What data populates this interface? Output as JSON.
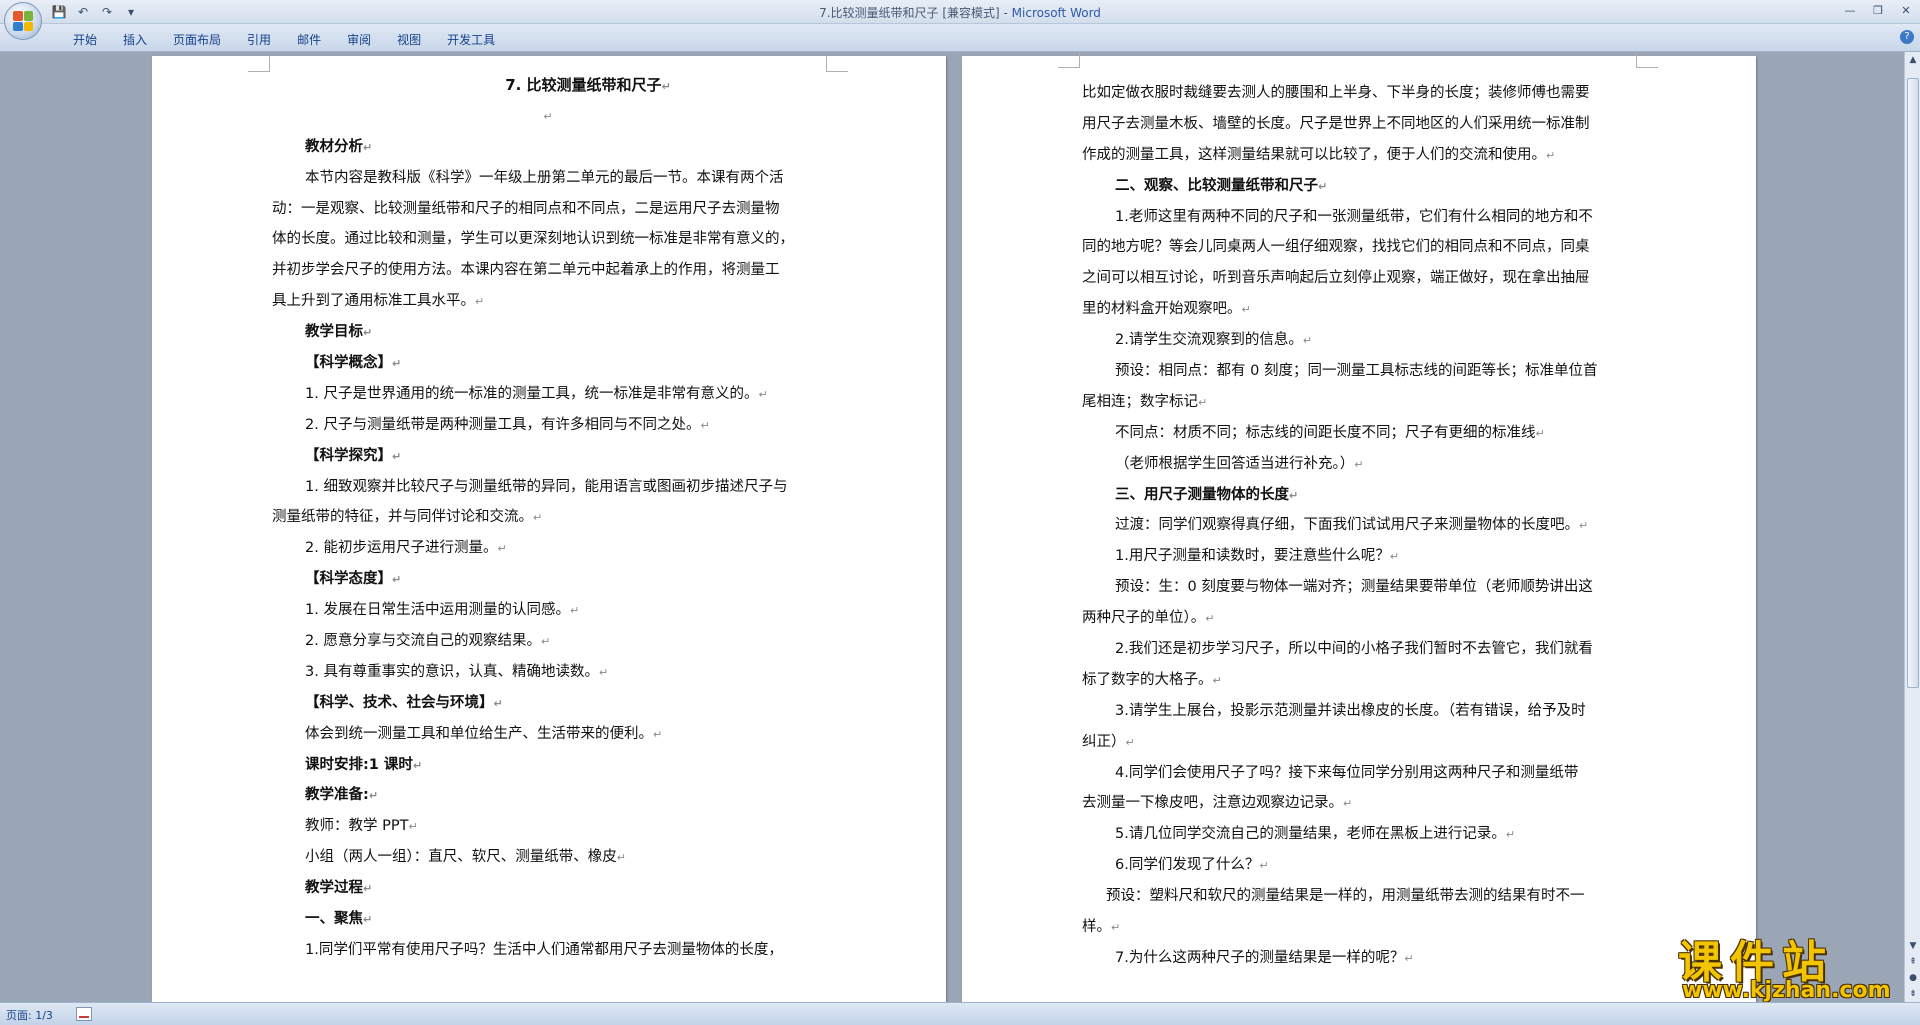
{
  "window": {
    "title_doc": "7.比较测量纸带和尺子 [兼容模式] - ",
    "title_app": "Microsoft Word"
  },
  "qat": {
    "save": "💾",
    "undo": "↶",
    "redo": "↷",
    "more": "▾"
  },
  "tabs": [
    "开始",
    "插入",
    "页面布局",
    "引用",
    "邮件",
    "审阅",
    "视图",
    "开发工具"
  ],
  "window_controls": {
    "minimize": "—",
    "restore": "❐",
    "close": "✕"
  },
  "paragraph_mark": "↵",
  "left_page": {
    "title": "7. 比较测量纸带和尺子",
    "lines": [
      {
        "text": "",
        "cls": "center"
      },
      {
        "text": "教材分析",
        "cls": "b ind"
      },
      {
        "text": "本节内容是教科版《科学》一年级上册第二单元的最后一节。本课有两个活",
        "cls": "ind",
        "noMark": true
      },
      {
        "text": "动：一是观察、比较测量纸带和尺子的相同点和不同点，二是运用尺子去测量物",
        "cls": "",
        "noMark": true
      },
      {
        "text": "体的长度。通过比较和测量，学生可以更深刻地认识到统一标准是非常有意义的，",
        "cls": "",
        "noMark": true
      },
      {
        "text": "并初步学会尺子的使用方法。本课内容在第二单元中起着承上的作用，将测量工",
        "cls": "",
        "noMark": true
      },
      {
        "text": "具上升到了通用标准工具水平。",
        "cls": ""
      },
      {
        "text": "教学目标",
        "cls": "b ind"
      },
      {
        "text": "【科学概念】",
        "cls": "b ind"
      },
      {
        "text": "1. 尺子是世界通用的统一标准的测量工具，统一标准是非常有意义的。",
        "cls": "ind"
      },
      {
        "text": "2. 尺子与测量纸带是两种测量工具，有许多相同与不同之处。",
        "cls": "ind"
      },
      {
        "text": "【科学探究】",
        "cls": "b ind"
      },
      {
        "text": "1. 细致观察并比较尺子与测量纸带的异同，能用语言或图画初步描述尺子与",
        "cls": "ind",
        "noMark": true
      },
      {
        "text": "测量纸带的特征，并与同伴讨论和交流。",
        "cls": ""
      },
      {
        "text": "2. 能初步运用尺子进行测量。",
        "cls": "ind"
      },
      {
        "text": "【科学态度】",
        "cls": "b ind"
      },
      {
        "text": "1. 发展在日常生活中运用测量的认同感。",
        "cls": "ind"
      },
      {
        "text": "2. 愿意分享与交流自己的观察结果。",
        "cls": "ind"
      },
      {
        "text": "3. 具有尊重事实的意识，认真、精确地读数。",
        "cls": "ind"
      },
      {
        "text": "【科学、技术、社会与环境】",
        "cls": "b ind"
      },
      {
        "text": "体会到统一测量工具和单位给生产、生活带来的便利。",
        "cls": "ind"
      },
      {
        "text": "课时安排:1 课时",
        "cls": "b ind"
      },
      {
        "text": "教学准备:",
        "cls": "b ind"
      },
      {
        "text": "教师：教学 PPT",
        "cls": "ind"
      },
      {
        "text": "小组（两人一组）：直尺、软尺、测量纸带、橡皮",
        "cls": "ind"
      },
      {
        "text": "教学过程",
        "cls": "b ind"
      },
      {
        "text": "一、聚焦",
        "cls": "b ind"
      },
      {
        "text": "1.同学们平常有使用尺子吗？生活中人们通常都用尺子去测量物体的长度，",
        "cls": "ind",
        "noMark": true
      }
    ]
  },
  "right_page": {
    "lines": [
      {
        "text": "比如定做衣服时裁缝要去测人的腰围和上半身、下半身的长度；装修师傅也需要",
        "cls": "",
        "noMark": true
      },
      {
        "text": "用尺子去测量木板、墙壁的长度。尺子是世界上不同地区的人们采用统一标准制",
        "cls": "",
        "noMark": true
      },
      {
        "text": "作成的测量工具，这样测量结果就可以比较了，便于人们的交流和使用。",
        "cls": ""
      },
      {
        "text": "二、观察、比较测量纸带和尺子",
        "cls": "b ind"
      },
      {
        "text": "1.老师这里有两种不同的尺子和一张测量纸带，它们有什么相同的地方和不",
        "cls": "ind",
        "noMark": true
      },
      {
        "text": "同的地方呢？等会儿同桌两人一组仔细观察，找找它们的相同点和不同点，同桌",
        "cls": "",
        "noMark": true
      },
      {
        "text": "之间可以相互讨论，听到音乐声响起后立刻停止观察，端正做好，现在拿出抽屉",
        "cls": "",
        "noMark": true
      },
      {
        "text": "里的材料盒开始观察吧。",
        "cls": ""
      },
      {
        "text": "2.请学生交流观察到的信息。",
        "cls": "ind"
      },
      {
        "text": "预设：相同点：都有 0 刻度；同一测量工具标志线的间距等长；标准单位首",
        "cls": "ind",
        "noMark": true
      },
      {
        "text": "尾相连；数字标记",
        "cls": ""
      },
      {
        "text": "不同点：材质不同；标志线的间距长度不同；尺子有更细的标准线",
        "cls": "ind"
      },
      {
        "text": "（老师根据学生回答适当进行补充。）",
        "cls": "ind"
      },
      {
        "text": "三、用尺子测量物体的长度",
        "cls": "b ind"
      },
      {
        "text": "过渡：同学们观察得真仔细，下面我们试试用尺子来测量物体的长度吧。",
        "cls": "ind"
      },
      {
        "text": "1.用尺子测量和读数时，要注意些什么呢？",
        "cls": "ind"
      },
      {
        "text": "预设：生：0 刻度要与物体一端对齐；测量结果要带单位（老师顺势讲出这",
        "cls": "ind",
        "noMark": true
      },
      {
        "text": "两种尺子的单位）。",
        "cls": ""
      },
      {
        "text": "2.我们还是初步学习尺子，所以中间的小格子我们暂时不去管它，我们就看",
        "cls": "ind",
        "noMark": true
      },
      {
        "text": "标了数字的大格子。",
        "cls": ""
      },
      {
        "text": "3.请学生上展台，投影示范测量并读出橡皮的长度。（若有错误，给予及时",
        "cls": "ind",
        "noMark": true
      },
      {
        "text": "纠正）",
        "cls": ""
      },
      {
        "text": "4.同学们会使用尺子了吗？接下来每位同学分别用这两种尺子和测量纸带",
        "cls": "ind",
        "noMark": true
      },
      {
        "text": "去测量一下橡皮吧，注意边观察边记录。",
        "cls": ""
      },
      {
        "text": "5.请几位同学交流自己的测量结果，老师在黑板上进行记录。",
        "cls": "ind"
      },
      {
        "text": "6.同学们发现了什么？",
        "cls": "ind"
      },
      {
        "text": "预设：塑料尺和软尺的测量结果是一样的，用测量纸带去测的结果有时不一",
        "cls": "ind-xs",
        "noMark": true
      },
      {
        "text": "样。",
        "cls": ""
      },
      {
        "text": "7.为什么这两种尺子的测量结果是一样的呢？",
        "cls": "ind"
      }
    ]
  },
  "statusbar": {
    "page": "页面: 1/3"
  },
  "watermark": {
    "main": "课件站",
    "url": "www.kjzhan.com"
  }
}
